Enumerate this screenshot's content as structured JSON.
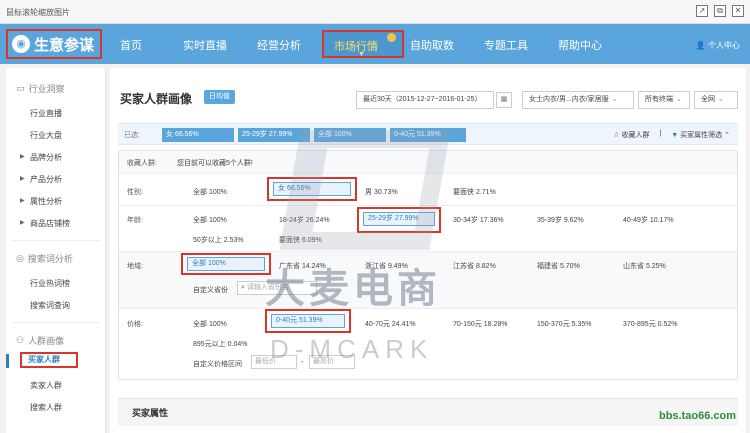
{
  "window": {
    "title": "鼠标滚轮缩放图片",
    "buttons": [
      "↗",
      "⧉",
      "✕"
    ]
  },
  "topnav": {
    "logo": "生意参谋",
    "items": [
      "首页",
      "实时直播",
      "经营分析",
      "市场行情",
      "自助取数",
      "专题工具",
      "帮助中心"
    ],
    "active": "市场行情",
    "user": "个人中心"
  },
  "sidebar": {
    "sections": [
      {
        "title": "行业洞察",
        "icon": "monitor-icon"
      },
      {
        "title": "搜索词分析",
        "icon": "eye-icon"
      },
      {
        "title": "人群画像",
        "icon": "users-icon"
      }
    ],
    "items": {
      "industry": [
        "行业直播",
        "行业大盘",
        "品牌分析",
        "产品分析",
        "属性分析",
        "商品店铺榜"
      ],
      "search": [
        "行业热词榜",
        "搜索词查询"
      ],
      "people": [
        "买家人群",
        "卖家人群",
        "搜索人群"
      ]
    },
    "active": "买家人群"
  },
  "main": {
    "title": "买家人群画像",
    "tag": "日均值",
    "date_range": "最近30天（2015-12-27~2016-01-25）",
    "category": "女士内衣/男...内衣/家居服",
    "terminal": "所有终端",
    "region": "全网",
    "selected": {
      "label": "已选:",
      "chips": [
        "女 66.56%",
        "25-29岁 27.99%",
        "全部 100%",
        "0-40元 51.39%"
      ],
      "collect": "收藏人群",
      "filter": "买家属性筛选"
    },
    "collected": {
      "label": "收藏人群:",
      "text": "您目前可以收藏5个人群!"
    },
    "rows": {
      "gender": {
        "label": "性别:",
        "cells": [
          "全部 100%",
          "女 66.56%",
          "男 30.73%",
          "要面侠 2.71%"
        ]
      },
      "age": {
        "label": "年龄:",
        "cells": [
          "全部 100%",
          "18-24岁 26.24%",
          "25-29岁 27.99%",
          "30-34岁 17.36%",
          "35-39岁 9.62%",
          "40-49岁 10.17%",
          "50岁以上 2.53%",
          "要面侠 6.09%"
        ]
      },
      "region": {
        "label": "地域:",
        "cells": [
          "全部 100%",
          "广东省 14.24%",
          "浙江省 9.49%",
          "江苏省 8.82%",
          "福建省 5.70%",
          "山东省 5.25%"
        ],
        "custom_label": "自定义省份",
        "custom_placeholder": "请输入省份名"
      },
      "price": {
        "label": "价格:",
        "cells": [
          "全部 100%",
          "0-40元 51.39%",
          "40-70元 24.41%",
          "70-150元 18.28%",
          "150-370元 5.35%",
          "370-895元 0.52%",
          "895元以上 0.04%"
        ],
        "custom_label": "自定义价格区间",
        "min_placeholder": "最低价",
        "max_placeholder": "最高价"
      }
    },
    "section2": "买家属性"
  },
  "watermark": {
    "main": "大麦电商",
    "sub": "D-MCARK"
  },
  "site_mark": "bbs.tao66.com"
}
